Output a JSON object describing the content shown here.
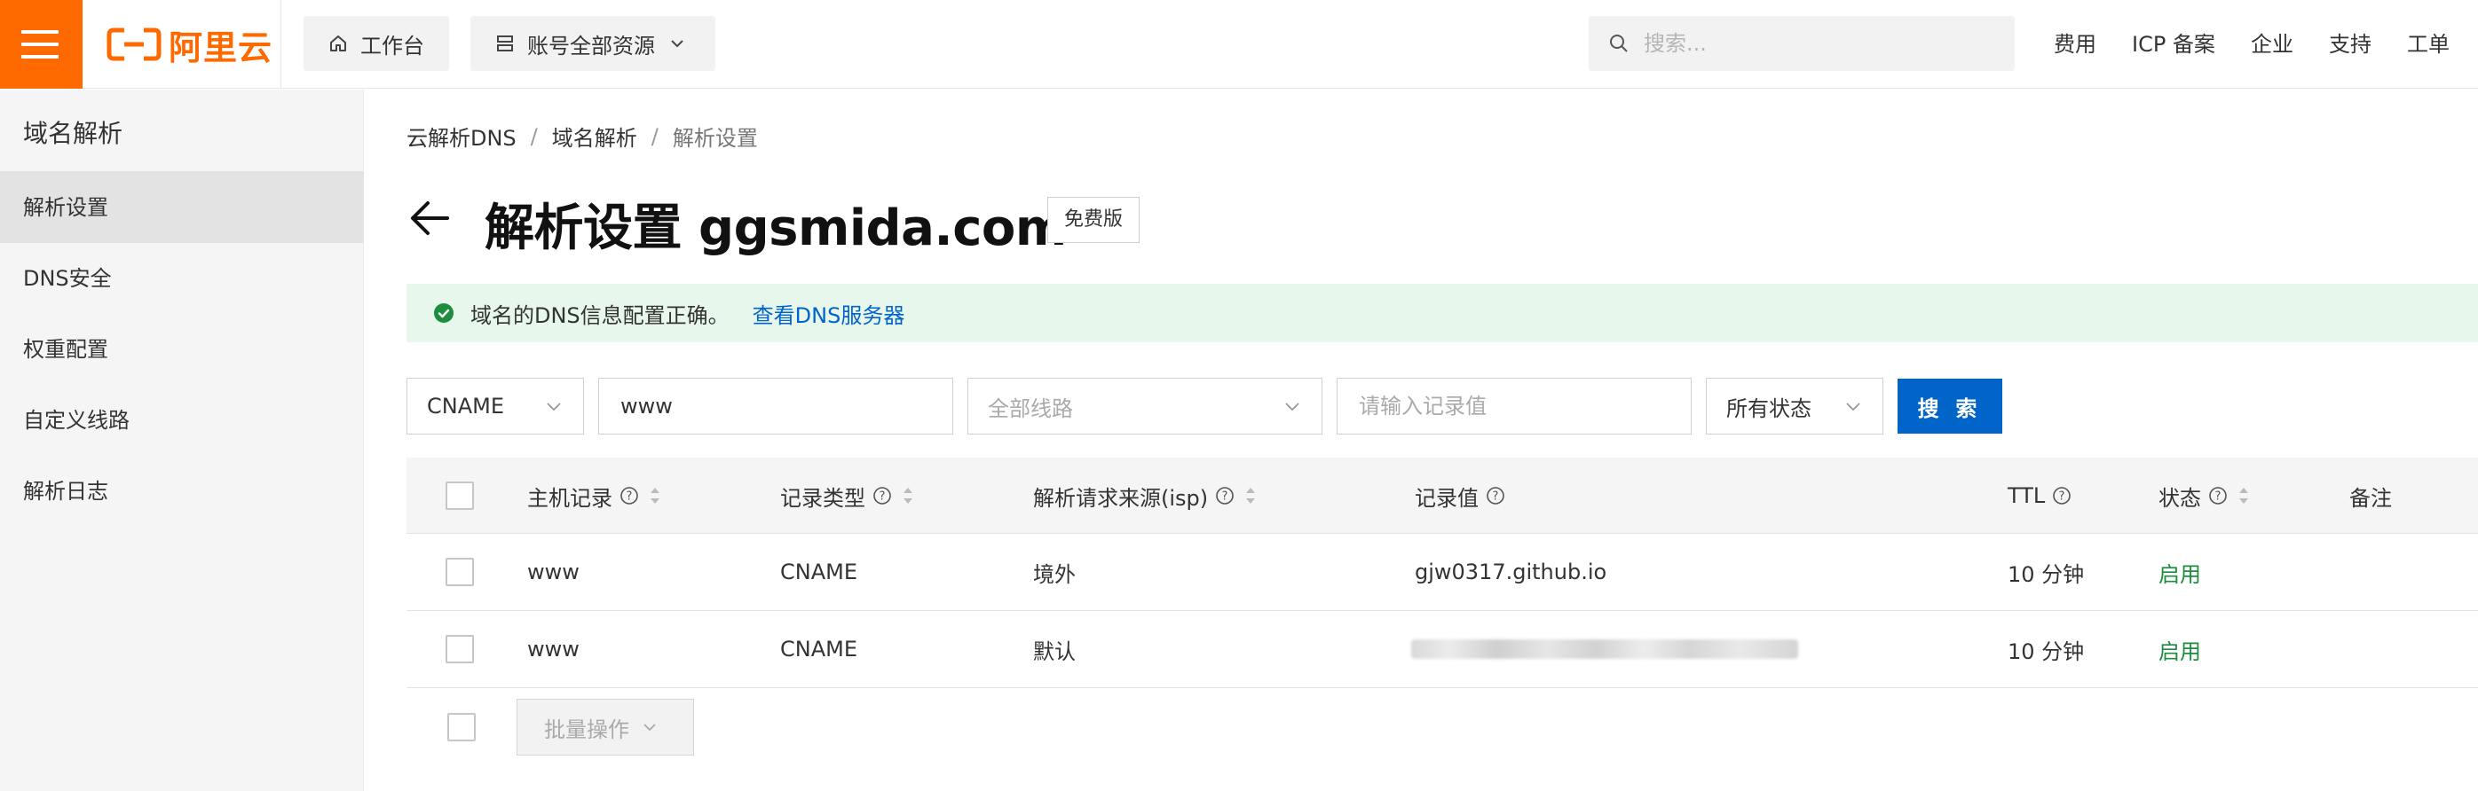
{
  "brand": {
    "name": "阿里云",
    "color": "#ff6a00"
  },
  "topbar": {
    "workbench_label": "工作台",
    "resources_label": "账号全部资源",
    "search_placeholder": "搜索...",
    "links": [
      "费用",
      "ICP 备案",
      "企业",
      "支持",
      "工单"
    ]
  },
  "sidebar": {
    "title": "域名解析",
    "items": [
      {
        "label": "解析设置",
        "active": true
      },
      {
        "label": "DNS安全"
      },
      {
        "label": "权重配置"
      },
      {
        "label": "自定义线路"
      },
      {
        "label": "解析日志"
      }
    ]
  },
  "breadcrumb": [
    "云解析DNS",
    "域名解析",
    "解析设置"
  ],
  "page": {
    "title": "解析设置 ggsmida.com",
    "edition": "免费版"
  },
  "alert": {
    "text": "域名的DNS信息配置正确。",
    "link": "查看DNS服务器",
    "icon": "check-circle-icon"
  },
  "filters": {
    "record_type": "CNAME",
    "host_value": "www",
    "line_placeholder": "全部线路",
    "value_placeholder": "请输入记录值",
    "status": "所有状态",
    "search_button": "搜 索"
  },
  "table": {
    "columns": [
      "主机记录",
      "记录类型",
      "解析请求来源(isp)",
      "记录值",
      "TTL",
      "状态",
      "备注"
    ],
    "rows": [
      {
        "host": "www",
        "type": "CNAME",
        "line": "境外",
        "value": "gjw0317.github.io",
        "ttl": "10 分钟",
        "status": "启用"
      },
      {
        "host": "www",
        "type": "CNAME",
        "line": "默认",
        "value": "",
        "ttl": "10 分钟",
        "status": "启用"
      }
    ],
    "batch_label": "批量操作"
  },
  "colors": {
    "accent": "#0064c8",
    "success": "#1e8e3e",
    "alert_bg": "#e8f7ec"
  }
}
